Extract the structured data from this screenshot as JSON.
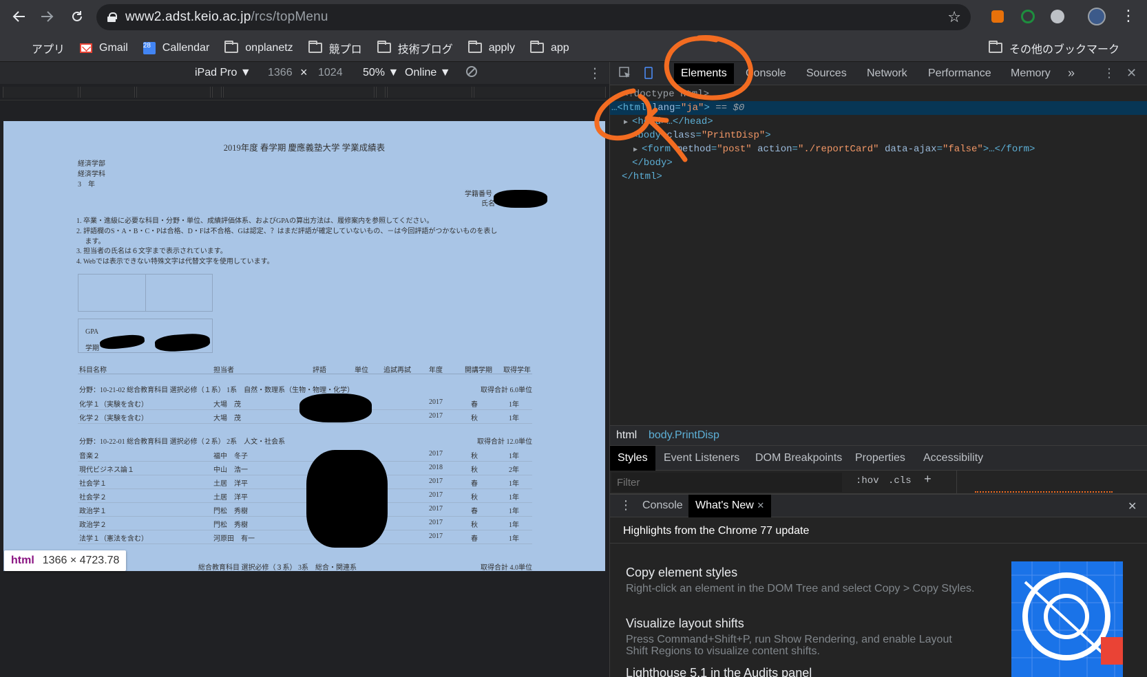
{
  "browser": {
    "url_host": "www2.adst.keio.ac.jp",
    "url_path": "/rcs/topMenu",
    "bookmarks": [
      "アプリ",
      "Gmail",
      "Callendar",
      "onplanetz",
      "競プロ",
      "技術ブログ",
      "apply",
      "app"
    ],
    "calendar_day": "28",
    "other_bookmarks": "その他のブックマーク"
  },
  "device_toolbar": {
    "device": "iPad Pro ▼",
    "width": "1366",
    "times": "×",
    "height": "1024",
    "zoom": "50% ▼",
    "network": "Online ▼"
  },
  "page": {
    "title": "2019年度 春学期 慶應義塾大学 学業成績表",
    "faculty": "経済学部",
    "department": "経済学科",
    "year": "3　年",
    "student_number_label": "学籍番号",
    "name_label": "氏名",
    "notes": [
      "1. 卒業・進級に必要な科目・分野・単位、成績評価体系、およびGPAの算出方法は、履修案内を参照してください。",
      "2. 評語欄のS・A・B・C・Pは合格、D・Fは不合格、Gは認定、？はまだ評語が確定していないもの、－は今回評語がつかないものを表し",
      "　 ます。",
      "3. 担当者の氏名は６文字まで表示されています。",
      "4. Webでは表示できない特殊文字は代替文字を使用しています。"
    ],
    "gpa_label": "GPA",
    "gakki_label": "学期",
    "table_headers": [
      "科目名称",
      "担当者",
      "評語",
      "単位",
      "追試再試",
      "年度",
      "開講学期",
      "取得学年"
    ],
    "sections": [
      {
        "label": "分野：10-21-02 総合教育科目 選択必修（１系） 1系　自然・数理系（生物・物理・化学）",
        "total": "取得合計 6.0単位",
        "rows": [
          [
            "化学１（実験を含む）",
            "大場　茂",
            "2017",
            "春",
            "1年"
          ],
          [
            "化学２（実験を含む）",
            "大場　茂",
            "2017",
            "秋",
            "1年"
          ]
        ]
      },
      {
        "label": "分野：10-22-01 総合教育科目 選択必修（２系） 2系　人文・社会系",
        "total": "取得合計 12.0単位",
        "rows": [
          [
            "音楽２",
            "福中　冬子",
            "2017",
            "秋",
            "1年"
          ],
          [
            "現代ビジネス論１",
            "中山　浩一",
            "2018",
            "秋",
            "2年"
          ],
          [
            "社会学１",
            "土居　洋平",
            "2017",
            "春",
            "1年"
          ],
          [
            "社会学２",
            "土居　洋平",
            "2017",
            "秋",
            "1年"
          ],
          [
            "政治学１",
            "門松　秀樹",
            "2017",
            "春",
            "1年"
          ],
          [
            "政治学２",
            "門松　秀樹",
            "2017",
            "秋",
            "1年"
          ],
          [
            "法学１（憲法を含む）",
            "河原田　有一",
            "2017",
            "春",
            "1年"
          ]
        ]
      },
      {
        "label": "総合教育科目 選択必修（３系） 3系　総合・関連系",
        "total": "取得合計 4.0単位",
        "rows": []
      }
    ],
    "size_tooltip": {
      "tag": "html",
      "dims": "1366 × 4723.78"
    }
  },
  "devtools": {
    "tabs": [
      "Elements",
      "Console",
      "Sources",
      "Network",
      "Performance",
      "Memory",
      "»"
    ],
    "dom": {
      "doctype": "<!doctype html>",
      "html_open_prefix": "…<html ",
      "html_attr": "lang",
      "html_attr_val": "\"ja\"",
      "html_ref": "== $0",
      "head": "<head>…</head>",
      "body_tag": "<body ",
      "body_attr": "class",
      "body_val": "\"PrintDisp\"",
      "form_tag": "<form ",
      "form_method": "method",
      "form_method_val": "\"post\"",
      "form_action": "action",
      "form_action_val": "\"./reportCard\"",
      "form_ajax": "data-ajax",
      "form_ajax_val": "\"false\"",
      "form_close": ">…</form>",
      "body_close": "</body>",
      "html_close": "</html>"
    },
    "breadcrumb": [
      "html",
      "body.PrintDisp"
    ],
    "subtabs": [
      "Styles",
      "Event Listeners",
      "DOM Breakpoints",
      "Properties",
      "Accessibility"
    ],
    "filter_placeholder": "Filter",
    "hov": ":hov",
    "cls": ".cls",
    "plus": "+",
    "drawer_tabs": [
      "Console",
      "What's New"
    ],
    "whats_new_header": "Highlights from the Chrome 77 update",
    "whats_new": [
      {
        "title": "Copy element styles",
        "desc": "Right-click an element in the DOM Tree and select Copy > Copy Styles."
      },
      {
        "title": "Visualize layout shifts",
        "desc": "Press Command+Shift+P, run Show Rendering, and enable Layout Shift Regions to visualize content shifts."
      },
      {
        "title": "Lighthouse 5.1 in the Audits panel",
        "desc": ""
      }
    ]
  },
  "colors": {
    "accent_annotation": "#f36c21",
    "page_background": "#a9c5e6",
    "selection": "#073655"
  }
}
